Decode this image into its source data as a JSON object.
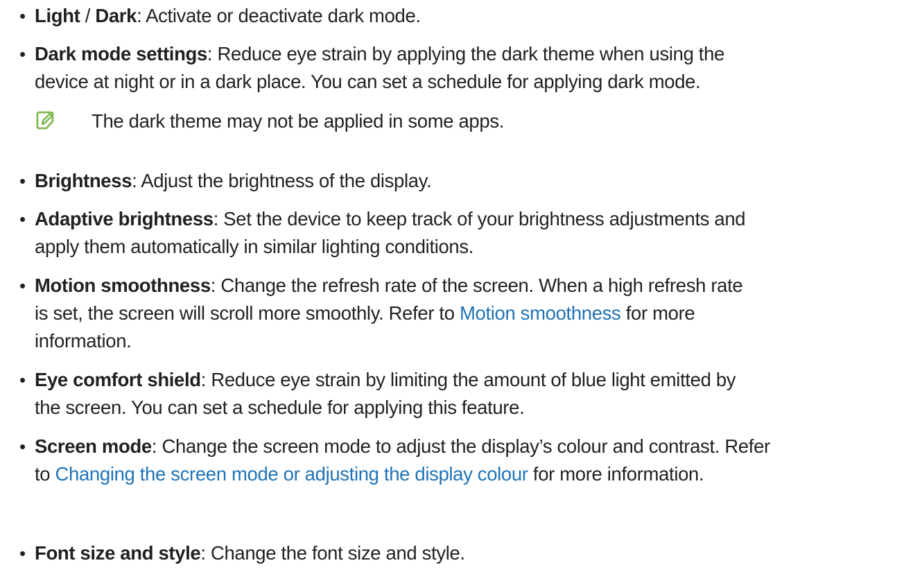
{
  "bullet_symbol": "•",
  "items": [
    {
      "term": "Light",
      "sep": " / ",
      "term2": "Dark",
      "desc": ": Activate or deactivate dark mode."
    },
    {
      "term": "Dark mode settings",
      "line1": ": Reduce eye strain by applying the dark theme when using the",
      "line2": "device at night or in a dark place. You can set a schedule for applying dark mode."
    },
    {
      "term": "Brightness",
      "desc": ": Adjust the brightness of the display."
    },
    {
      "term": "Adaptive brightness",
      "line1": ": Set the device to keep track of your brightness adjustments and",
      "line2": "apply them automatically in similar lighting conditions."
    },
    {
      "term": "Motion smoothness",
      "line1": ": Change the refresh rate of the screen. When a high refresh rate",
      "line2_pre": "is set, the screen will scroll more smoothly. Refer to ",
      "line2_link": "Motion smoothness",
      "line2_post": " for more",
      "line3": "information."
    },
    {
      "term": "Eye comfort shield",
      "line1": ": Reduce eye strain by limiting the amount of blue light emitted by",
      "line2": "the screen. You can set a schedule for applying this feature."
    },
    {
      "term": "Screen mode",
      "line1": ": Change the screen mode to adjust the display’s colour and contrast. Refer",
      "line2_pre": "to ",
      "line2_link": "Changing the screen mode or adjusting the display colour",
      "line2_post": " for more information."
    },
    {
      "term": "Font size and style",
      "desc": ": Change the font size and style."
    }
  ],
  "note": {
    "icon": "note-pencil-icon",
    "text": "The dark theme may not be applied in some apps."
  },
  "colors": {
    "text": "#231f20",
    "link": "#1f73b7",
    "note_icon": "#7ab648"
  }
}
